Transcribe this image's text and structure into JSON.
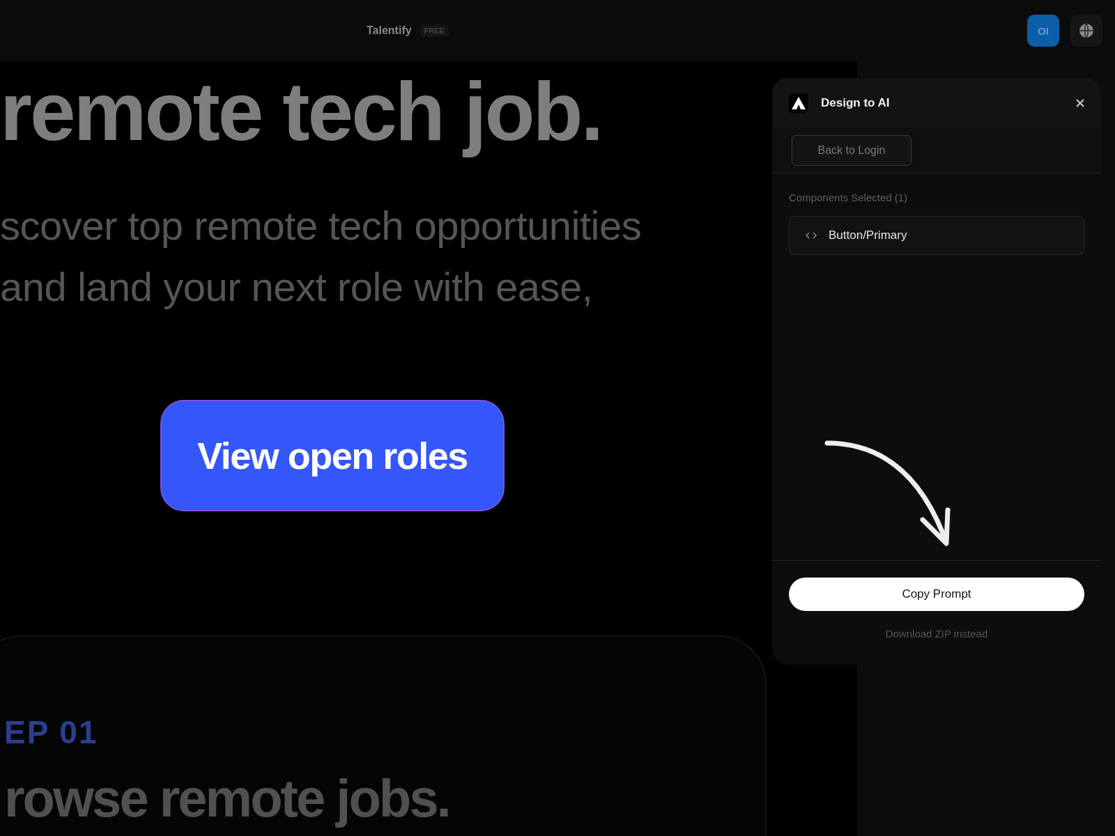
{
  "top_bar": {
    "brand": "Talentify",
    "badge": "FREE",
    "avatar_initials": "OI"
  },
  "canvas": {
    "headline": "remote tech job.",
    "subtitle_lines": [
      "scover top remote tech opportunities",
      "and land your next role with ease,"
    ],
    "cta_label": "View open roles",
    "step_label": "EP 01",
    "step_title": "rowse remote jobs."
  },
  "panel": {
    "title": "Design to AI",
    "back_button": "Back to Login",
    "section_label": "Components Selected (1)",
    "components": [
      "Button/Primary"
    ],
    "primary_button": "Copy Prompt",
    "secondary_link": "Download ZIP instead"
  }
}
